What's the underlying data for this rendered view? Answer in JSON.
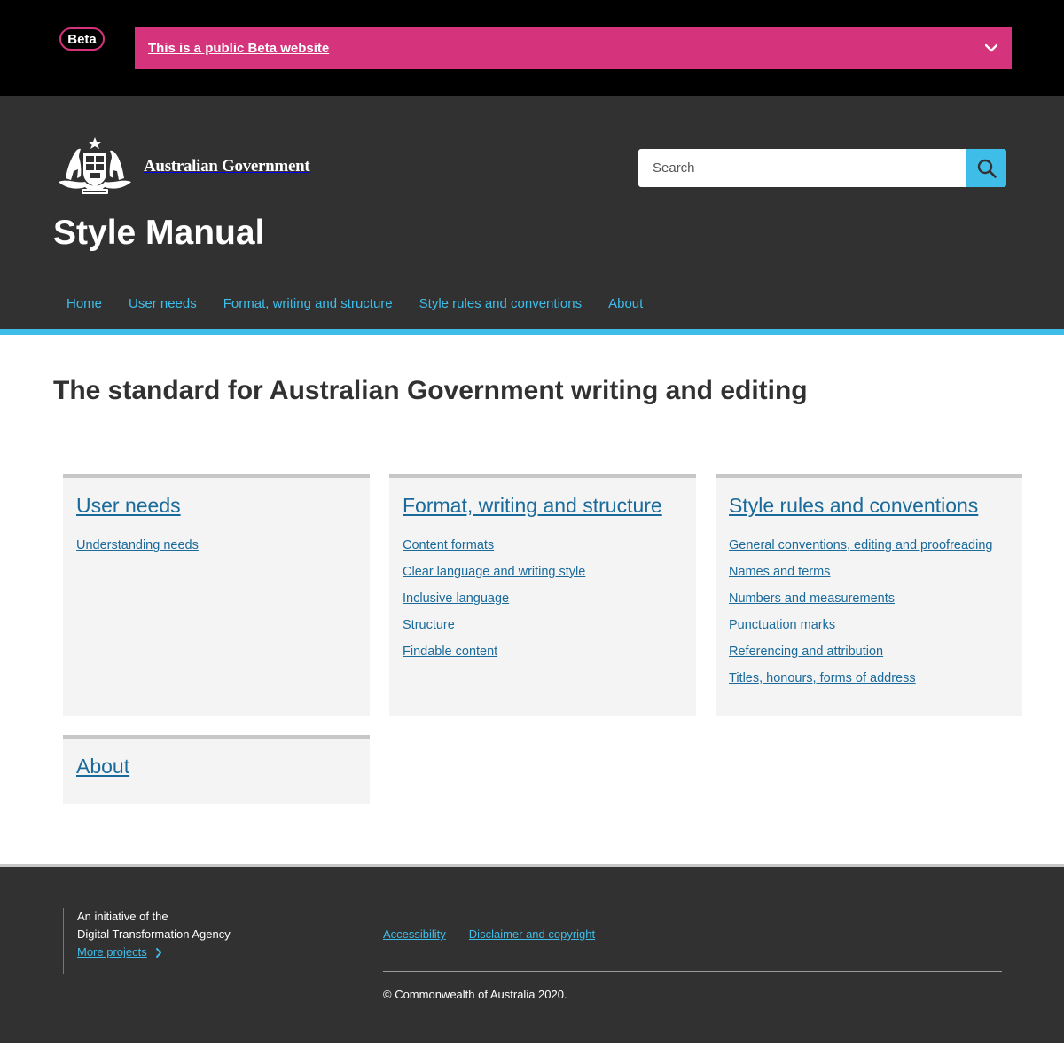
{
  "beta": {
    "badge": "Beta",
    "banner_text": "This is a public Beta website",
    "toggle_icon": "chevron-down-icon"
  },
  "header": {
    "logo_text": "Australian Government",
    "logo_icon": "coat-of-arms-crest-icon",
    "site_title": "Style Manual",
    "search": {
      "placeholder": "Search",
      "button_icon": "search-icon"
    },
    "nav": [
      "Home",
      "User needs",
      "Format, writing and structure",
      "Style rules and conventions",
      "About"
    ]
  },
  "colors": {
    "beta_pink": "#d6337d",
    "header_bg": "#313131",
    "accent_blue": "#3fbde9",
    "link_blue": "#1a6a9b",
    "card_bg": "#f4f4f4"
  },
  "main": {
    "heading": "The standard for Australian Government writing and editing",
    "cards": [
      {
        "title": "User needs",
        "links": [
          "Understanding needs"
        ]
      },
      {
        "title": "Format, writing and structure",
        "links": [
          "Content formats",
          "Clear language and writing style",
          "Inclusive language",
          "Structure",
          "Findable content"
        ]
      },
      {
        "title": "Style rules and conventions",
        "links": [
          "General conventions, editing and proofreading",
          "Names and terms",
          "Numbers and measurements",
          "Punctuation marks",
          "Referencing and attribution",
          "Titles, honours, forms of address"
        ]
      },
      {
        "title": "About",
        "links": []
      }
    ]
  },
  "footer": {
    "intro_line1": "An initiative of the",
    "intro_line2": "Digital Transformation Agency",
    "more_projects": "More projects",
    "links": [
      "Accessibility",
      "Disclaimer and copyright"
    ],
    "copyright": "© Commonwealth of Australia 2020."
  }
}
